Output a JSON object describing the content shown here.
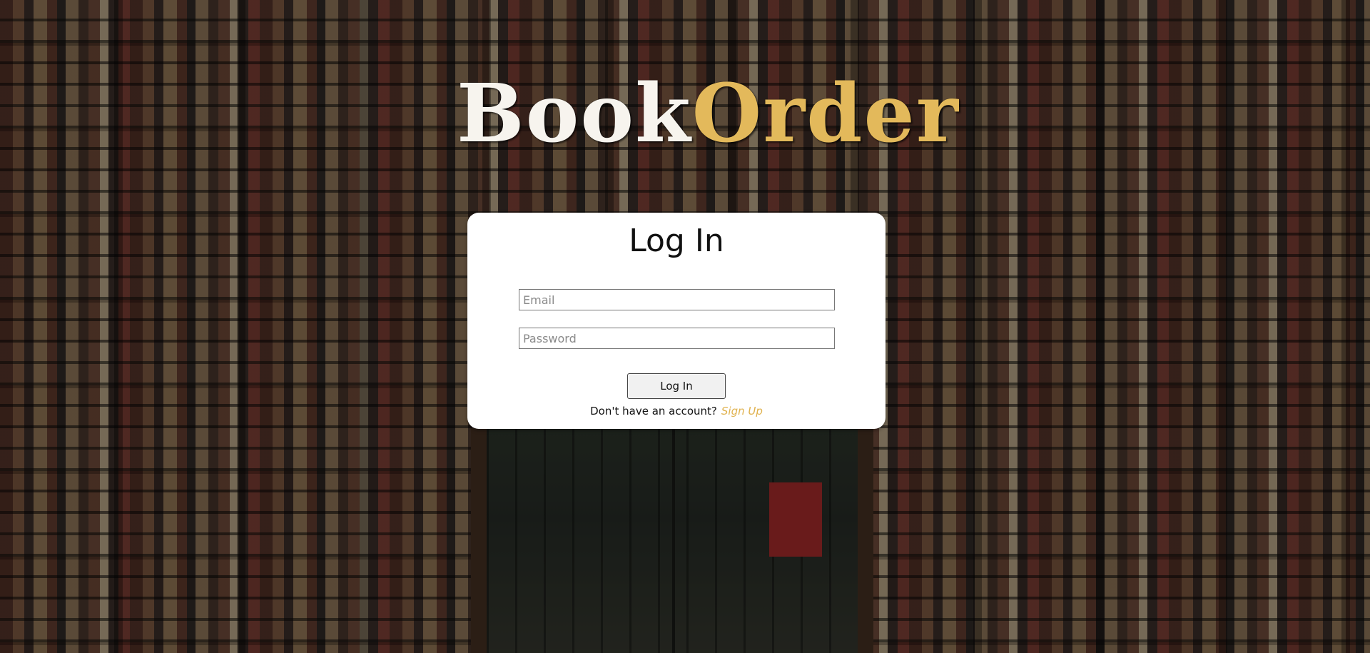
{
  "brand": {
    "logo_part1": "Book",
    "logo_part2": "Order",
    "colors": {
      "logo_white": "#f7f4ee",
      "logo_accent": "#e3b95b"
    }
  },
  "login": {
    "title": "Log In",
    "email_placeholder": "Email",
    "password_placeholder": "Password",
    "submit_label": "Log In",
    "no_account_text": "Don't have an account?",
    "signup_link": "Sign Up",
    "colors": {
      "link": "#e0b24e",
      "card_bg": "#ffffff"
    }
  }
}
